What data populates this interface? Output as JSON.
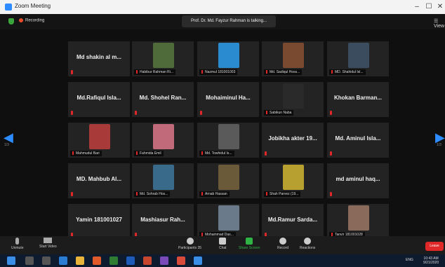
{
  "window": {
    "title": "Zoom Meeting",
    "minimize": "–",
    "maximize": "☐",
    "close": "✕"
  },
  "topbar": {
    "recording": "Recording",
    "speaking": "Prof. Dr. Md. Fayzur Rahman is talking...",
    "view": "View"
  },
  "pager": {
    "left": "1/3",
    "right": "1/3"
  },
  "tiles": [
    {
      "name": "Md shakin al m...",
      "label": "",
      "photo": false
    },
    {
      "name": "",
      "label": "Habibur Rahman Ri...",
      "photo": true,
      "color": "#4f6b3a"
    },
    {
      "name": "",
      "label": "Nazmul 181001003",
      "photo": true,
      "color": "#2a8bd0"
    },
    {
      "name": "",
      "label": "Md. Sadiqul Hoss...",
      "photo": true,
      "color": "#7a4a30"
    },
    {
      "name": "",
      "label": "MD. Shahidul Isl...",
      "photo": true,
      "color": "#3a4c5e"
    },
    {
      "name": "Md.Rafiqul Isla...",
      "label": "",
      "photo": false
    },
    {
      "name": "Md. Shohel Ran...",
      "label": "",
      "photo": false
    },
    {
      "name": "Mohaiminul Ha...",
      "label": "",
      "photo": false
    },
    {
      "name": "",
      "label": "Sabikun Naba",
      "photo": true,
      "color": "#2a2a2a"
    },
    {
      "name": "Khokan Barman...",
      "label": "",
      "photo": false
    },
    {
      "name": "",
      "label": "Mahmudul Bari",
      "photo": true,
      "color": "#a83a3a"
    },
    {
      "name": "",
      "label": "Fahmida Emil",
      "photo": true,
      "color": "#c06a7a"
    },
    {
      "name": "",
      "label": "Md. Towhidul Is...",
      "photo": true,
      "color": "#5a5a5a"
    },
    {
      "name": "Jobikha akter 19...",
      "label": "",
      "photo": false
    },
    {
      "name": "Md. Aminul Isla...",
      "label": "",
      "photo": false
    },
    {
      "name": "MD. Mahbub Al...",
      "label": "",
      "photo": false
    },
    {
      "name": "",
      "label": "Md. Sohrab Hos...",
      "photo": true,
      "color": "#3a6a8a"
    },
    {
      "name": "",
      "label": "Arnab Hassan",
      "photo": true,
      "color": "#6a5a3a"
    },
    {
      "name": "",
      "label": "Shah Parvez (19...",
      "photo": true,
      "color": "#b8a030"
    },
    {
      "name": "md aminul haq...",
      "label": "",
      "photo": false
    },
    {
      "name": "Yamin 181001027",
      "label": "",
      "photo": false
    },
    {
      "name": "Mashiasur Rah...",
      "label": "",
      "photo": false
    },
    {
      "name": "",
      "label": "Mohammad Das...",
      "photo": true,
      "color": "#6a7a8a"
    },
    {
      "name": "Md.Ramur Sarda...",
      "label": "",
      "photo": false
    },
    {
      "name": "",
      "label": "Tanvir 181001028",
      "photo": true,
      "color": "#8a6a5a"
    }
  ],
  "toolbar": {
    "unmute": "Unmute",
    "start_video": "Start Video",
    "participants": "Participants",
    "participants_count": "35",
    "chat": "Chat",
    "share": "Share Screen",
    "record": "Record",
    "reactions": "Reactions",
    "end": "Leave"
  },
  "taskbar": {
    "time": "10:43 AM",
    "date": "9/21/2020",
    "lang": "ENG"
  }
}
